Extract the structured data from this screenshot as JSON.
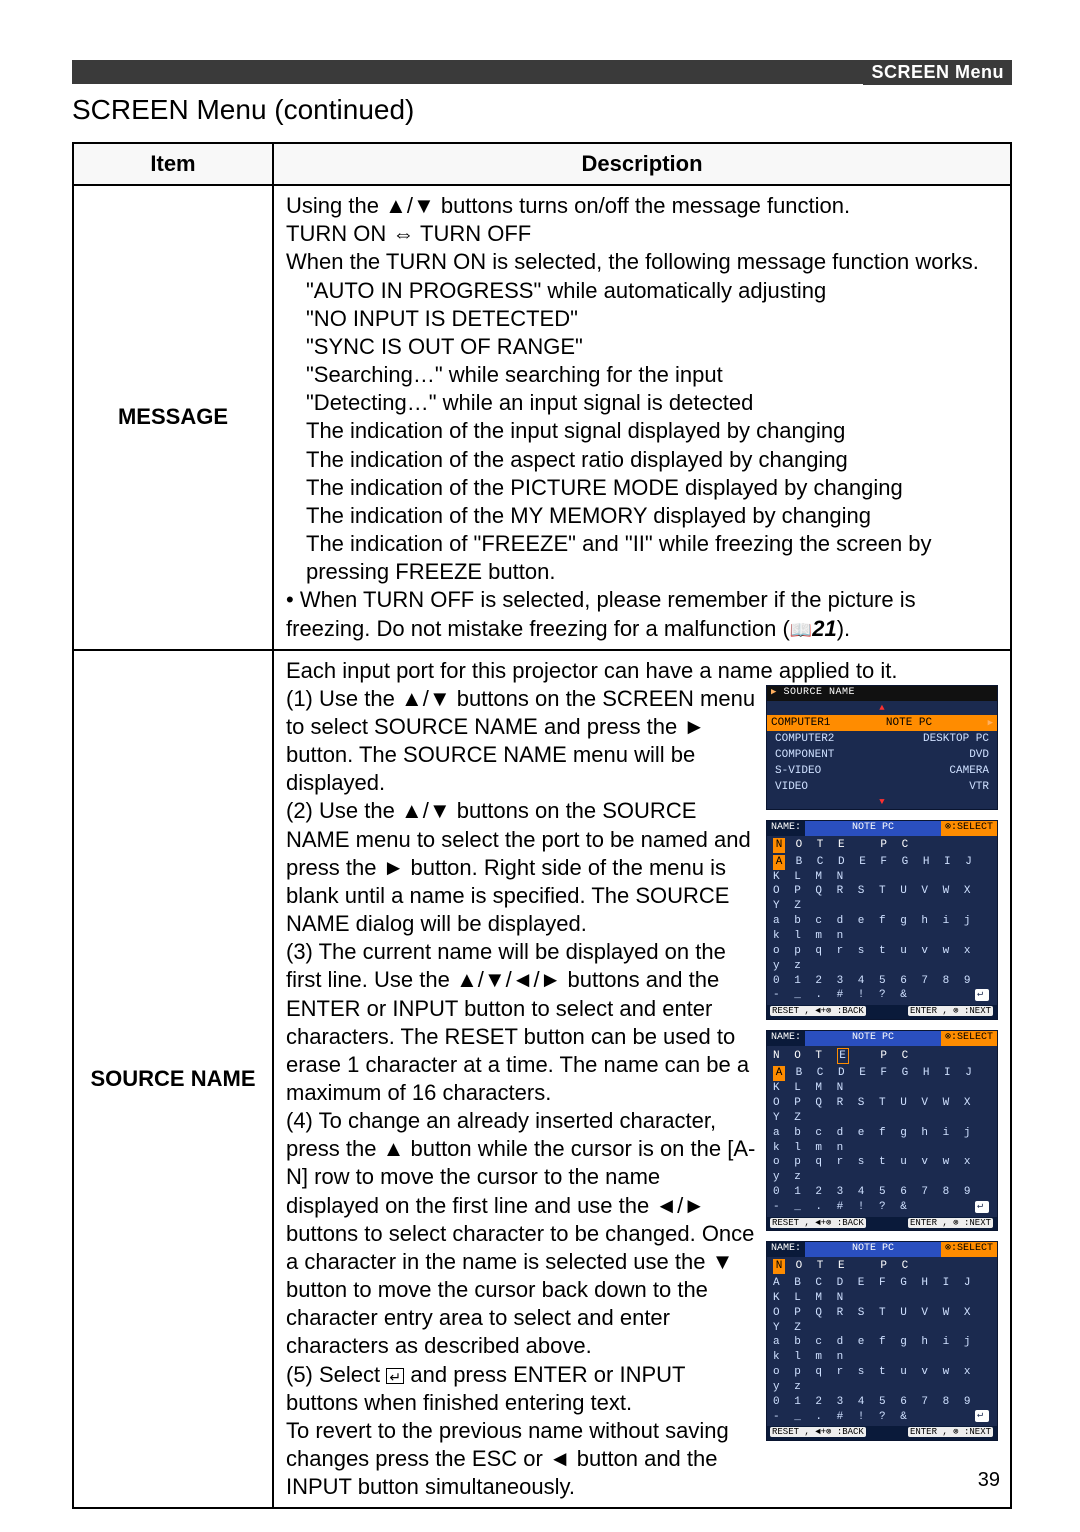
{
  "header": {
    "tab": "SCREEN Menu"
  },
  "heading": "SCREEN Menu (continued)",
  "table": {
    "col_item": "Item",
    "col_desc": "Description",
    "rows": [
      {
        "item": "MESSAGE",
        "l1": "Using the ▲/▼ buttons turns on/off the message function.",
        "l2": "TURN ON ⇔ TURN OFF",
        "l3": "When the TURN ON is selected, the following message function works.",
        "l4": "\"AUTO IN PROGRESS\" while automatically adjusting",
        "l5": "\"NO INPUT IS DETECTED\"",
        "l6": "\"SYNC IS OUT OF RANGE\"",
        "l7": "\"Searching…\" while searching for the input",
        "l8": "\"Detecting…\" while an input signal is detected",
        "l9": "The indication of the input signal displayed by changing",
        "l10": "The indication of the aspect ratio displayed by changing",
        "l11": "The indication of the PICTURE MODE displayed by changing",
        "l12": "The indication of the MY MEMORY displayed by changing",
        "l13": "The indication of \"FREEZE\" and \"II\" while freezing the screen by pressing FREEZE button.",
        "l14a": "• When TURN OFF is selected, please remember if the picture is freezing. Do not mistake freezing for a malfunction (",
        "l14b": "21",
        "l14c": ")."
      },
      {
        "item": "SOURCE NAME",
        "intro": "Each input port for this projector can have a name applied to it.",
        "s1": "(1) Use the ▲/▼ buttons on the SCREEN menu to select SOURCE NAME and press the ► button. The SOURCE NAME menu will be displayed.",
        "s2": "(2) Use the ▲/▼ buttons on the SOURCE NAME menu to select the port to be named and press the ► button. Right side of the menu is blank until a name is specified. The SOURCE NAME dialog will be displayed.",
        "s3": "(3) The current name will be displayed on the first line. Use the ▲/▼/◄/► buttons and the ENTER or INPUT button to select and enter characters. The RESET button can be used to erase 1 character at a time. The name can be a maximum of 16 characters.",
        "s4": "(4) To change an already inserted character, press the ▲ button while the cursor is on the [A-N] row to move the cursor to the name displayed on the first line and use the ◄/► buttons to select character to be changed. Once a character in the name is selected use the ▼ button to move the cursor back down to the character entry area to select and enter characters as described above.",
        "s5a": "(5) Select ",
        "s5b": " and press ENTER or INPUT buttons when finished entering text.",
        "s6": "To revert to the previous name without saving changes press the ESC or ◄ button and the INPUT button simultaneously."
      }
    ]
  },
  "osd_source": {
    "title": "SOURCE NAME",
    "r1a": "COMPUTER1",
    "r1b": "NOTE PC",
    "r2a": "COMPUTER2",
    "r2b": "DESKTOP PC",
    "r3a": "COMPONENT",
    "r3b": "DVD",
    "r4a": "S-VIDEO",
    "r4b": "CAMERA",
    "r5a": "VIDEO",
    "r5b": "VTR"
  },
  "osd_kbd": {
    "name_lbl": "NAME:",
    "name_val": "NOTE PC",
    "sel": "⊗:SELECT",
    "entry1": "N O T E   P C",
    "entry2": "N O T E   P C",
    "entry3": "N O T E   P C",
    "row_upper": "A B C D E F G H I J K L M N",
    "row_upper2": "O P Q R S T U V W X Y Z",
    "row_lower": "a b c d e f g h i j k l m n",
    "row_lower2": "o p q r s t u v w x y z",
    "row_num": "0 1 2 3 4 5 6 7 8 9",
    "row_sym": "- _ . # ! ? &",
    "foot_l": "RESET , ◄+⊗ :BACK",
    "foot_r": "ENTER , ⊗ :NEXT"
  },
  "page_number": "39"
}
